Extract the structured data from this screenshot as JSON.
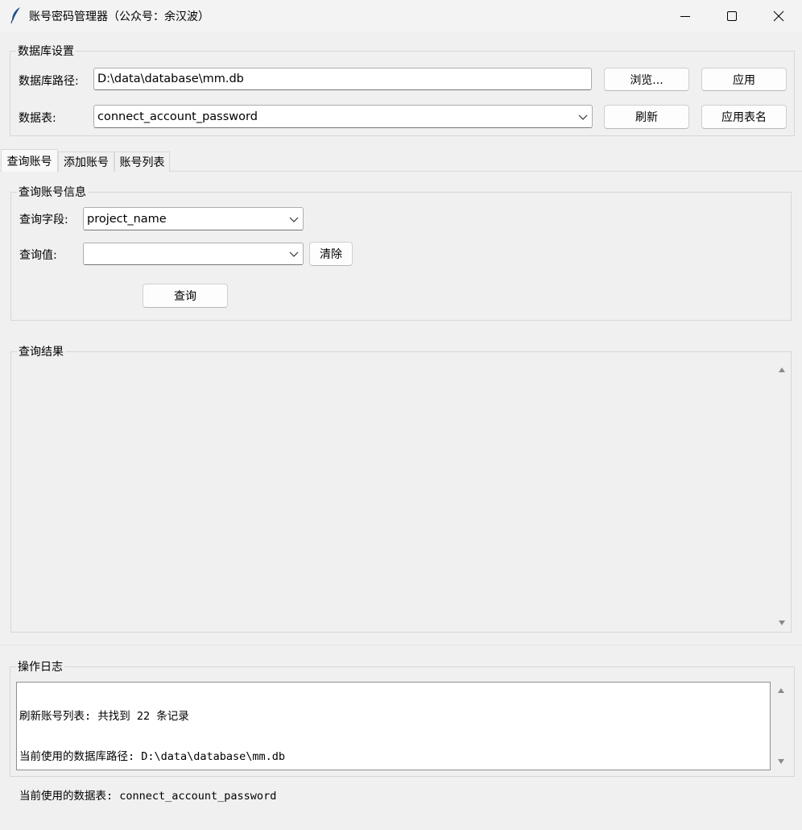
{
  "window": {
    "title": "账号密码管理器（公众号：余汉波）",
    "icon": "feather-icon",
    "controls": [
      "minimize-icon",
      "maximize-icon",
      "close-icon"
    ]
  },
  "db_settings": {
    "legend": "数据库设置",
    "path_label": "数据库路径:",
    "path_value": "D:\\data\\database\\mm.db",
    "browse_label": "浏览...",
    "apply_label": "应用",
    "table_label": "数据表:",
    "table_value": "connect_account_password",
    "refresh_label": "刷新",
    "apply_table_label": "应用表名"
  },
  "tabs": [
    {
      "label": "查询账号",
      "active": true
    },
    {
      "label": "添加账号",
      "active": false
    },
    {
      "label": "账号列表",
      "active": false
    }
  ],
  "query": {
    "legend": "查询账号信息",
    "field_label": "查询字段:",
    "field_value": "project_name",
    "value_label": "查询值:",
    "value_value": "",
    "clear_label": "清除",
    "search_label": "查询"
  },
  "results": {
    "legend": "查询结果"
  },
  "log": {
    "legend": "操作日志",
    "lines": [
      "刷新账号列表: 共找到 22 条记录",
      "当前使用的数据库路径: D:\\data\\database\\mm.db",
      "当前使用的数据表: connect_account_password"
    ]
  },
  "colors": {
    "window_bg": "#f0f0f0",
    "titlebar_bg": "#f3f3f3",
    "border": "#d6d6d6",
    "icon_blue": "#1f4e8c"
  }
}
